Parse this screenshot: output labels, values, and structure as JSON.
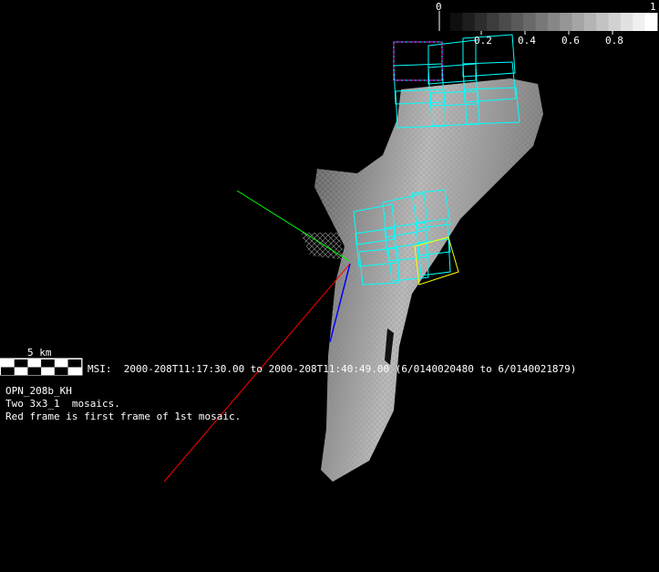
{
  "colorbar": {
    "min_label": "0",
    "max_label": "1",
    "ticks": [
      "0.2",
      "0.4",
      "0.6",
      "0.8"
    ],
    "steps": 17
  },
  "scale_bar": {
    "label": "5 km"
  },
  "info": {
    "msi_line": "MSI:  2000-208T11:17:30.00 to 2000-208T11:40:49.00 (6/0140020480 to 6/0140021879)",
    "name": "OPN_208b_KH",
    "line2": "Two 3x3_1  mosaics.",
    "line3": "Red frame is first frame of 1st mosaic."
  },
  "colors": {
    "frames": "#00ffff",
    "first_frame": "#ff00ff",
    "highlight": "#ffff00",
    "axis_x": "#ff0000",
    "axis_y": "#00ff00",
    "axis_z": "#0000ff"
  }
}
